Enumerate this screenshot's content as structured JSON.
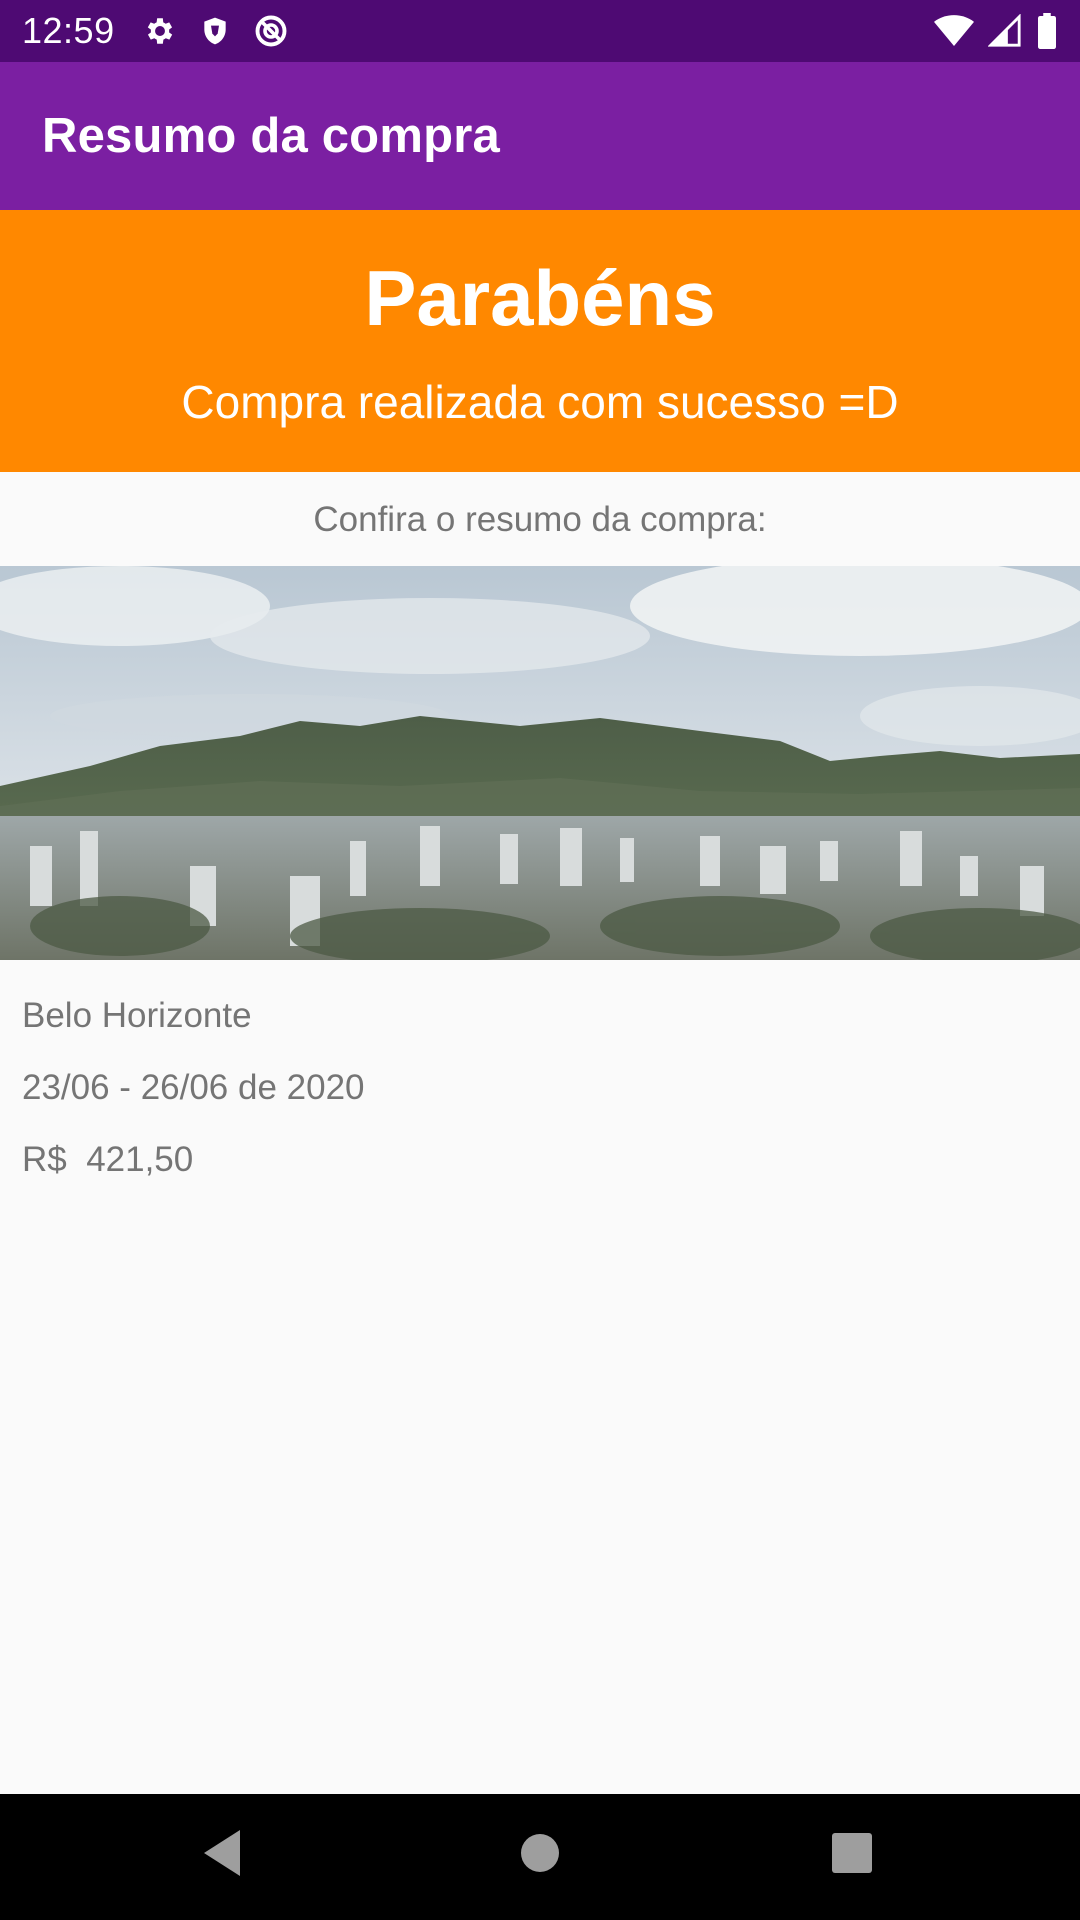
{
  "status_bar": {
    "time": "12:59",
    "left_icons": [
      "gear-icon",
      "shield-icon",
      "do-not-disturb-icon"
    ],
    "right_icons": [
      "wifi-icon",
      "signal-icon",
      "battery-icon"
    ]
  },
  "app_bar": {
    "title": "Resumo da compra",
    "color": "#7B1FA2"
  },
  "banner": {
    "title": "Parabéns",
    "subtitle": "Compra realizada com sucesso =D",
    "color": "#FF8800"
  },
  "summary": {
    "caption": "Confira o resumo da compra:",
    "image": "city-skyline-photo",
    "place": "Belo Horizonte",
    "dates": "23/06 - 26/06 de 2020",
    "price": "R$  421,50"
  },
  "nav_bar": {
    "buttons": [
      "back-icon",
      "home-icon",
      "recents-icon"
    ]
  }
}
